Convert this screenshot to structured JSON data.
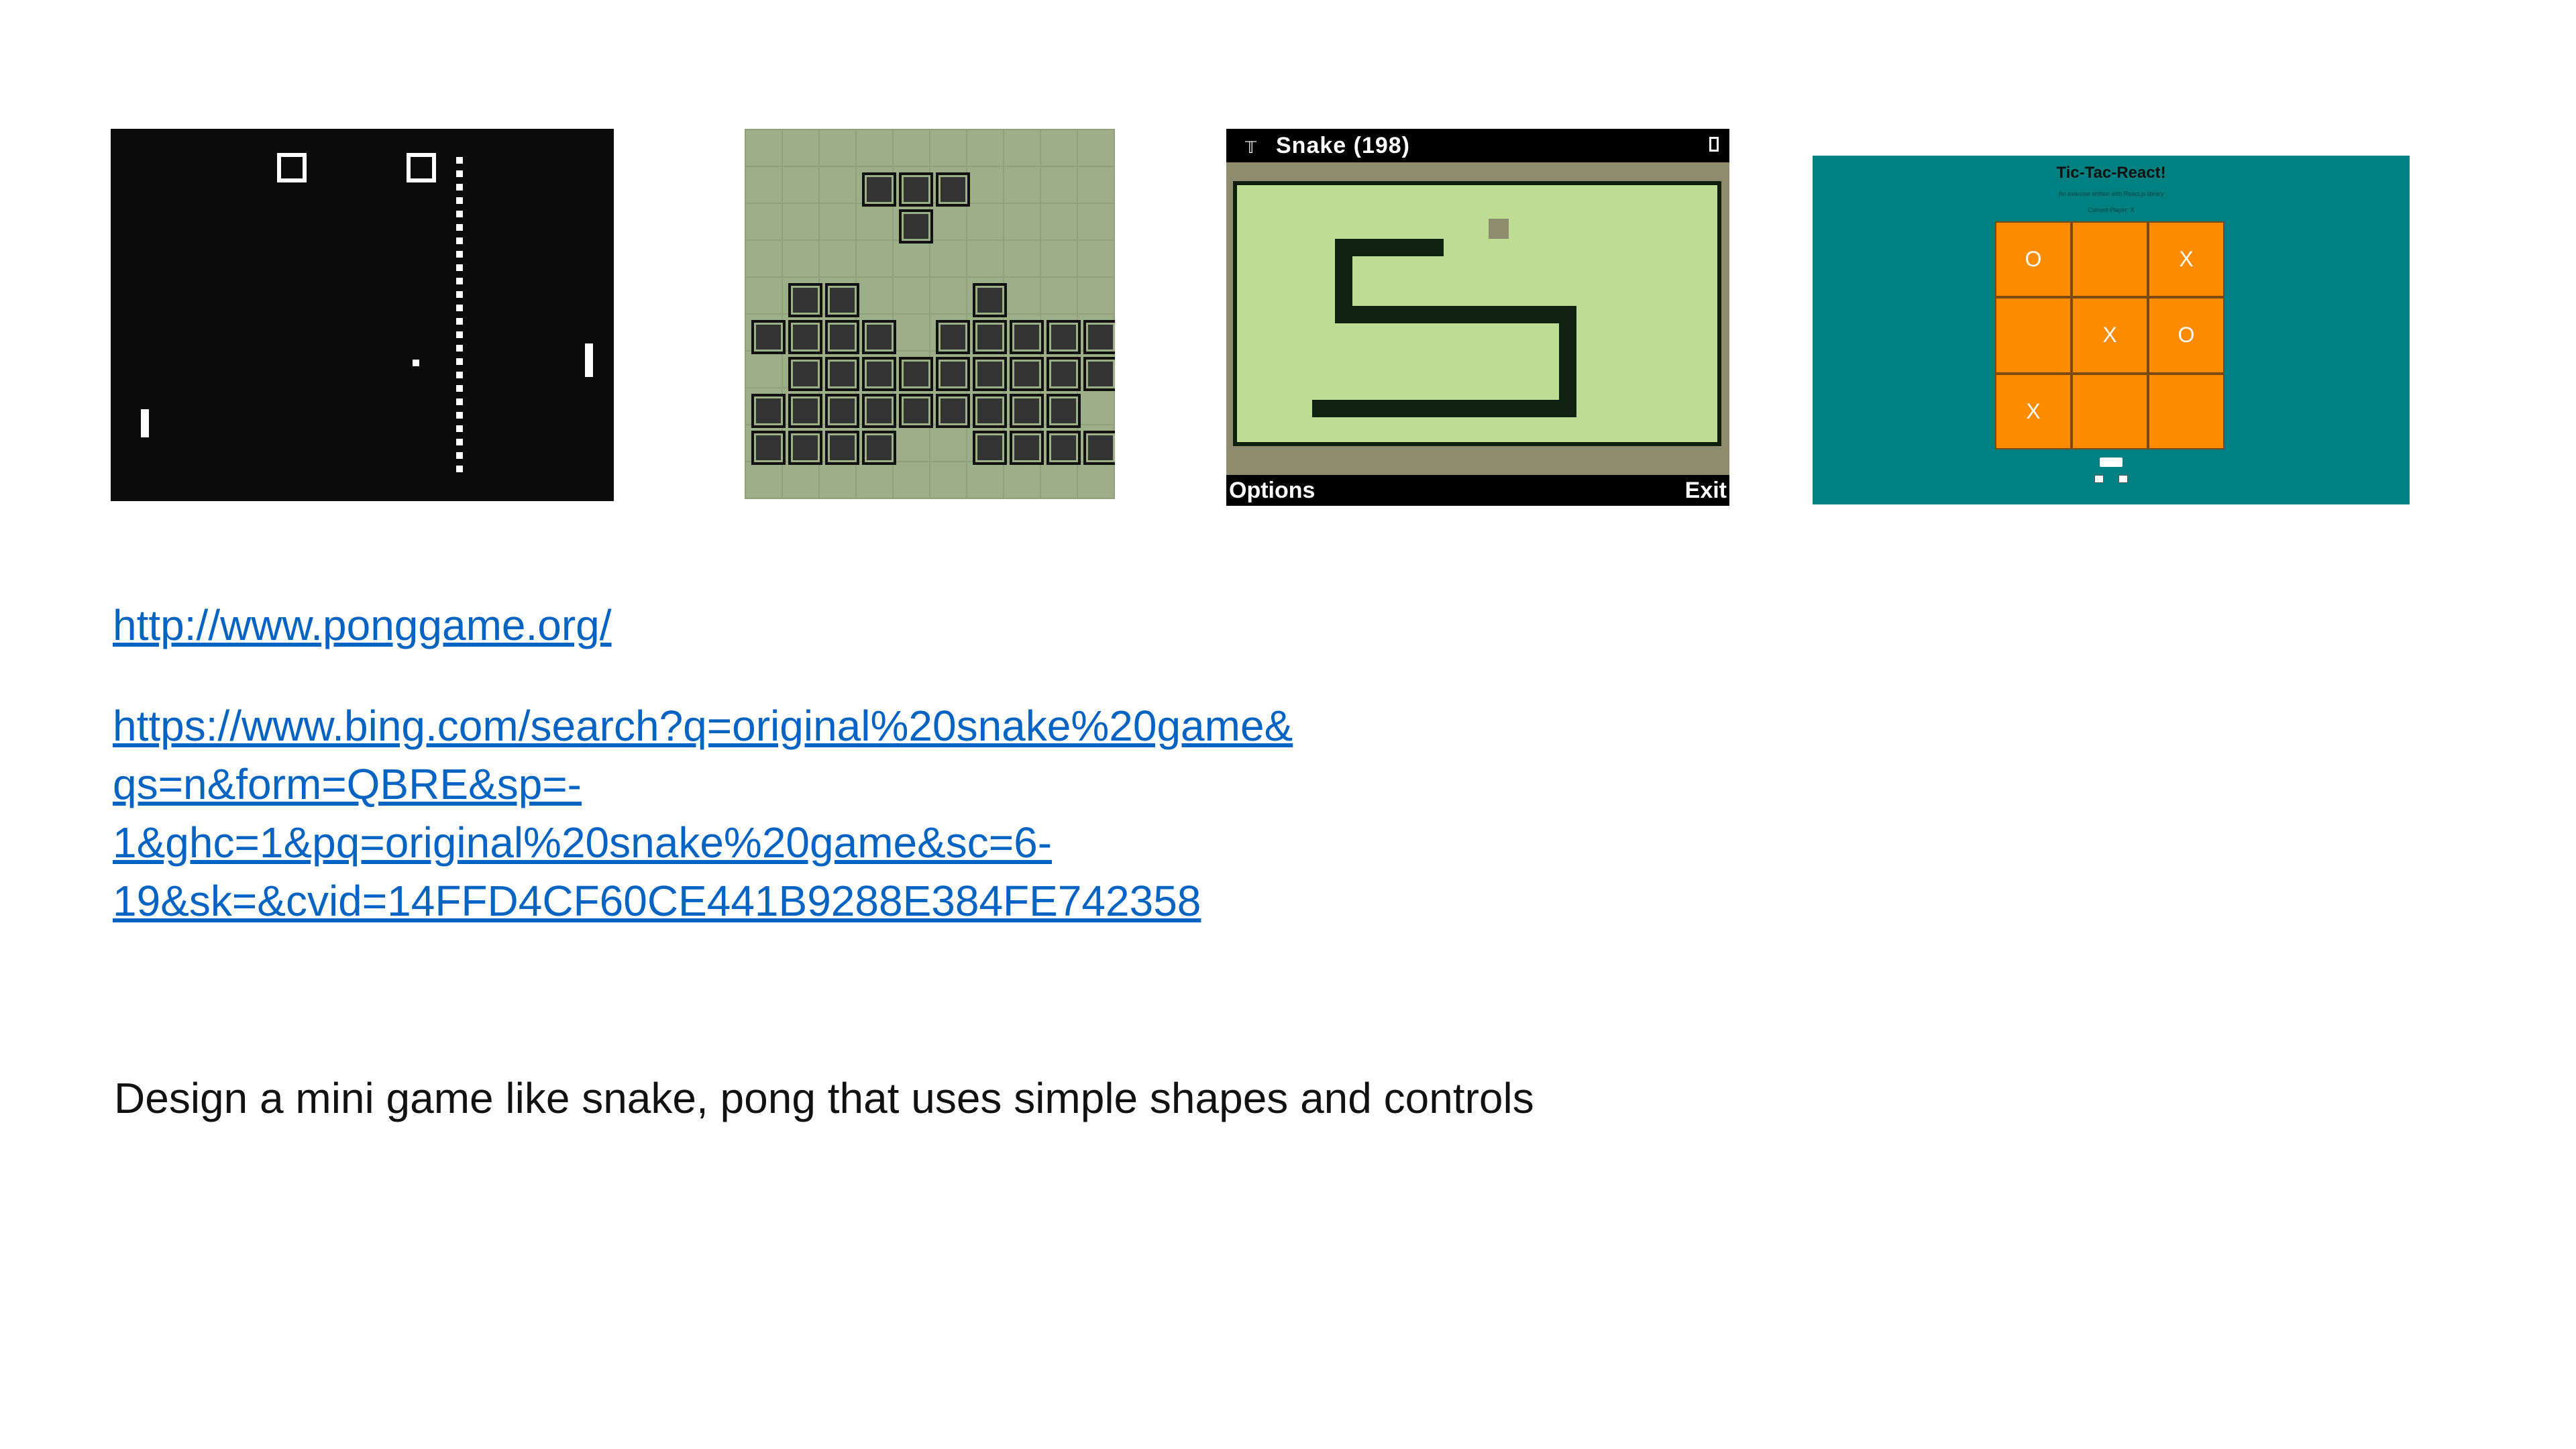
{
  "snake_screen": {
    "title": "Snake (198)",
    "left_softkey": "Options",
    "right_softkey": "Exit"
  },
  "tictactoe": {
    "title": "Tic-Tac-React!",
    "subtitle": "An exercise written with React.js library",
    "current_player": "Current Player: X",
    "board": [
      "O",
      "",
      "X",
      "",
      "X",
      "O",
      "X",
      "",
      ""
    ]
  },
  "links": {
    "pong_url": "http://www.ponggame.org/",
    "bing_url_lines": [
      "https://www.bing.com/search?q=original%20snake%20game&",
      "qs=n&form=QBRE&sp=-",
      "1&ghc=1&pq=original%20snake%20game&sc=6-",
      "19&sk=&cvid=14FFD4CF60CE441B9288E384FE742358"
    ]
  },
  "task_text": "Design a mini game like snake, pong that uses simple shapes and controls"
}
